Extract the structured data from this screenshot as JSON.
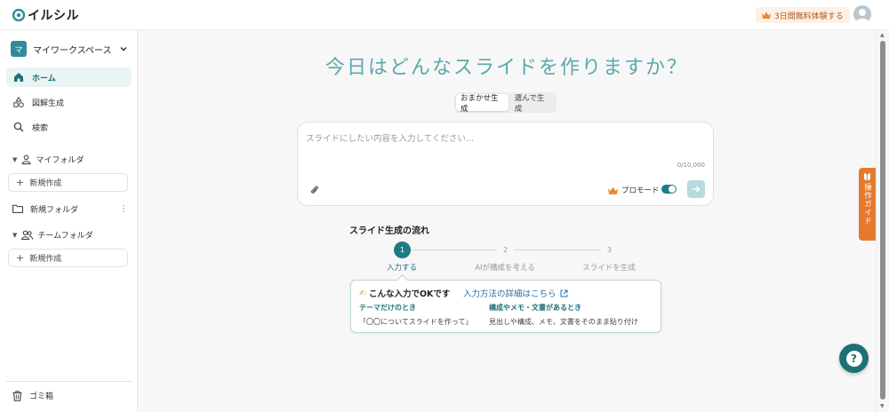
{
  "header": {
    "logo_text": "イルシル",
    "trial_label": "3日間無料体験する"
  },
  "sidebar": {
    "workspace_badge": "マ",
    "workspace_name": "マイワークスペース",
    "nav": [
      {
        "label": "ホーム",
        "icon": "home-icon",
        "active": true
      },
      {
        "label": "図解生成",
        "icon": "shapes-icon",
        "active": false
      },
      {
        "label": "検索",
        "icon": "search-icon",
        "active": false
      }
    ],
    "my_folder_label": "マイフォルダ",
    "new_create_label": "新規作成",
    "folder_name": "新規フォルダ",
    "team_folder_label": "チームフォルダ",
    "trash_label": "ゴミ箱"
  },
  "main": {
    "headline": "今日はどんなスライドを作りますか？",
    "modes": [
      "おまかせ生成",
      "選んで生成"
    ],
    "input_placeholder": "スライドにしたい内容を入力してください...",
    "char_count": "0/10,000",
    "promo_label": "プロモード",
    "flow_title": "スライド生成の流れ",
    "steps": [
      {
        "num": "1",
        "label": "入力する"
      },
      {
        "num": "2",
        "label": "AIが構成を考える"
      },
      {
        "num": "3",
        "label": "スライドを生成"
      }
    ],
    "tip": {
      "emoji": "✍",
      "heading": "こんな入力でOKです",
      "link": "入力方法の詳細はこちら",
      "col1_title": "テーマだけのとき",
      "col1_text": "「〇〇についてスライドを作って」",
      "col2_title": "構成やメモ・文書があるとき",
      "col2_text": "見出しや構成、メモ、文書をそのまま貼り付け"
    },
    "guide_label": "操作ガイド"
  },
  "colors": {
    "accent": "#1f7a84",
    "headline": "#5aa8ad",
    "guide": "#e57a2e"
  }
}
